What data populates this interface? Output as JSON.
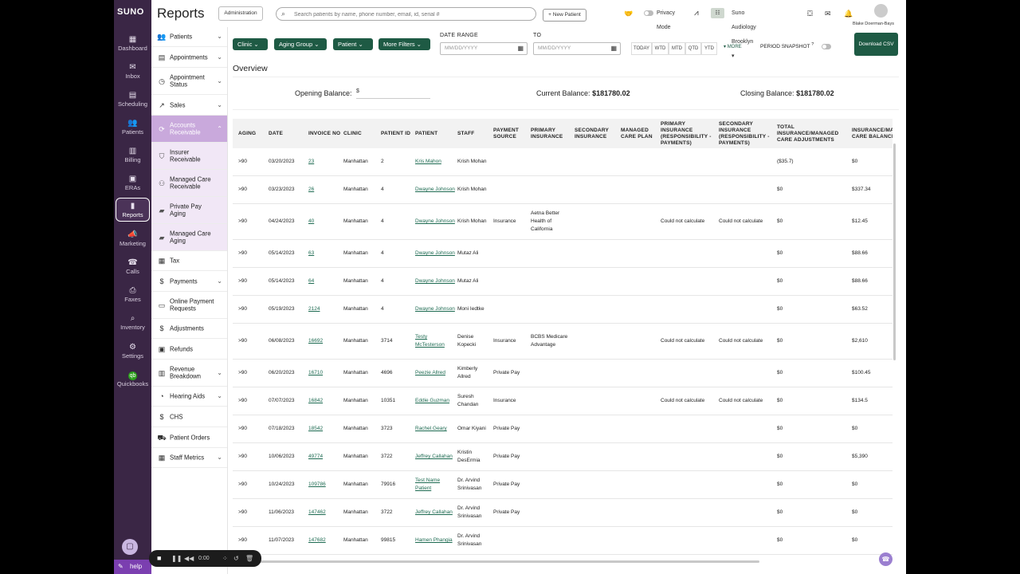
{
  "rail": {
    "logo": "SUNO",
    "items": [
      {
        "label": "Dashboard",
        "icon": "dashboard-icon",
        "glyph": "▦"
      },
      {
        "label": "Inbox",
        "icon": "inbox-icon",
        "glyph": "✉"
      },
      {
        "label": "Scheduling",
        "icon": "calendar-icon",
        "glyph": "▤"
      },
      {
        "label": "Patients",
        "icon": "patients-icon",
        "glyph": "👥"
      },
      {
        "label": "Billing",
        "icon": "billing-icon",
        "glyph": "▥"
      },
      {
        "label": "ERAs",
        "icon": "eras-icon",
        "glyph": "▣"
      },
      {
        "label": "Reports",
        "icon": "reports-icon",
        "glyph": "▮"
      },
      {
        "label": "Marketing",
        "icon": "megaphone-icon",
        "glyph": "📣"
      },
      {
        "label": "Calls",
        "icon": "phone-icon",
        "glyph": "☎"
      },
      {
        "label": "Faxes",
        "icon": "fax-icon",
        "glyph": "⎙"
      },
      {
        "label": "Inventory",
        "icon": "inventory-icon",
        "glyph": "⌕"
      },
      {
        "label": "Settings",
        "icon": "gear-icon",
        "glyph": "⚙"
      },
      {
        "label": "Quickbooks",
        "icon": "quickbooks-icon",
        "glyph": "qb"
      }
    ],
    "help_label": "help"
  },
  "header": {
    "title": "Reports",
    "admin_label": "Administration",
    "search_placeholder": "Search patients by name, phone number, email, id, serial #",
    "new_patient_label": "+ New Patient",
    "privacy_label": "Privacy Mode",
    "location_label": "Suno Audiology Brooklyn",
    "user_name": "Blake Doerman-Bays"
  },
  "sidebar": [
    {
      "label": "Patients",
      "icon": "patients-icon",
      "glyph": "👥",
      "chevron": true
    },
    {
      "label": "Appointments",
      "icon": "calendar-icon",
      "glyph": "▤",
      "chevron": true
    },
    {
      "label": "Appointment Status",
      "icon": "clock-icon",
      "glyph": "◷",
      "chevron": true
    },
    {
      "label": "Sales",
      "icon": "trend-icon",
      "glyph": "↗",
      "chevron": true
    },
    {
      "label": "Accounts Receivable",
      "icon": "receivable-icon",
      "glyph": "⟳",
      "chevron": true,
      "open": true
    },
    {
      "label": "Insurer Receivable",
      "icon": "shield-icon",
      "glyph": "⛉",
      "sub": true
    },
    {
      "label": "Managed Care Receivable",
      "icon": "care-icon",
      "glyph": "⚇",
      "sub": true
    },
    {
      "label": "Private Pay Aging",
      "icon": "folder-icon",
      "glyph": "▰",
      "sub": true
    },
    {
      "label": "Managed Care Aging",
      "icon": "folder-icon",
      "glyph": "▰",
      "sub": true
    },
    {
      "label": "Tax",
      "icon": "tax-icon",
      "glyph": "▦"
    },
    {
      "label": "Payments",
      "icon": "dollar-icon",
      "glyph": "$",
      "chevron": true
    },
    {
      "label": "Online Payment Requests",
      "icon": "card-icon",
      "glyph": "▭"
    },
    {
      "label": "Adjustments",
      "icon": "dollar-icon",
      "glyph": "$"
    },
    {
      "label": "Refunds",
      "icon": "refund-icon",
      "glyph": "▣"
    },
    {
      "label": "Revenue Breakdown",
      "icon": "revenue-icon",
      "glyph": "▥",
      "chevron": true
    },
    {
      "label": "Hearing Aids",
      "icon": "hearing-aid-icon",
      "glyph": "◔",
      "chevron": true
    },
    {
      "label": "CHS",
      "icon": "dollar-icon",
      "glyph": "$"
    },
    {
      "label": "Patient Orders",
      "icon": "truck-icon",
      "glyph": "⛟"
    },
    {
      "label": "Staff Metrics",
      "icon": "metrics-icon",
      "glyph": "▦",
      "chevron": true
    }
  ],
  "filters": {
    "buttons": [
      "Clinic",
      "Aging Group",
      "Patient",
      "More Filters"
    ],
    "date_range_label": "DATE RANGE",
    "to_label": "TO",
    "date_placeholder": "MM/DD/YYYY",
    "quick_ranges": [
      "TODAY",
      "WTD",
      "MTD",
      "QTD",
      "YTD"
    ],
    "more_label": "MORE",
    "snapshot_label": "PERIOD SNAPSHOT",
    "download_label": "Download CSV"
  },
  "overview": {
    "title": "Overview",
    "opening_label": "Opening Balance:",
    "opening_value": "$",
    "current_label": "Current Balance:",
    "current_value": "$181780.02",
    "closing_label": "Closing Balance:",
    "closing_value": "$181780.02"
  },
  "table": {
    "columns": [
      "AGING",
      "DATE",
      "INVOICE NO",
      "CLINIC",
      "PATIENT ID",
      "PATIENT",
      "STAFF",
      "PAYMENT SOURCE",
      "PRIMARY INSURANCE",
      "SECONDARY INSURANCE",
      "MANAGED CARE PLAN",
      "PRIMARY INSURANCE (RESPONSIBILITY - PAYMENTS)",
      "SECONDARY INSURANCE (RESPONSIBILITY - PAYMENTS)",
      "TOTAL INSURANCE/MANAGED CARE ADJUSTMENTS",
      "INSURANCE/MANAGED CARE BALANCE"
    ],
    "rows": [
      [
        ">90",
        "03/20/2023",
        "23",
        "Manhattan",
        "2",
        "Kris Mahon",
        "Krish Mohan",
        "",
        "",
        "",
        "",
        "",
        "",
        "($35.7)",
        "$0"
      ],
      [
        ">90",
        "03/23/2023",
        "26",
        "Manhattan",
        "4",
        "Dwayne Johnson",
        "Krish Mohan",
        "",
        "",
        "",
        "",
        "",
        "",
        "$0",
        "$337.34"
      ],
      [
        ">90",
        "04/24/2023",
        "40",
        "Manhattan",
        "4",
        "Dwayne Johnson",
        "Krish Mohan",
        "Insurance",
        "Aetna Better Health of California",
        "",
        "",
        "Could not calculate",
        "Could not calculate",
        "$0",
        "$12.45"
      ],
      [
        ">90",
        "05/14/2023",
        "63",
        "Manhattan",
        "4",
        "Dwayne Johnson",
        "Mutaz Ali",
        "",
        "",
        "",
        "",
        "",
        "",
        "$0",
        "$88.66"
      ],
      [
        ">90",
        "05/14/2023",
        "64",
        "Manhattan",
        "4",
        "Dwayne Johnson",
        "Mutaz Ali",
        "",
        "",
        "",
        "",
        "",
        "",
        "$0",
        "$88.66"
      ],
      [
        ">90",
        "05/19/2023",
        "2124",
        "Manhattan",
        "4",
        "Dwayne Johnson",
        "Moni Iedtke",
        "",
        "",
        "",
        "",
        "",
        "",
        "$0",
        "$63.52"
      ],
      [
        ">90",
        "06/08/2023",
        "16692",
        "Manhattan",
        "3714",
        "Testy McTesterson",
        "Denise Kopecki",
        "Insurance",
        "BCBS Medicare Advantage",
        "",
        "",
        "Could not calculate",
        "Could not calculate",
        "$0",
        "$2,610"
      ],
      [
        ">90",
        "06/20/2023",
        "16710",
        "Manhattan",
        "4696",
        "Peezie Allred",
        "Kimberly Allred",
        "Private Pay",
        "",
        "",
        "",
        "",
        "",
        "$0",
        "$100.45"
      ],
      [
        ">90",
        "07/07/2023",
        "16842",
        "Manhattan",
        "10351",
        "Eddie Guzman",
        "Suresh Chandan",
        "Insurance",
        "",
        "",
        "",
        "Could not calculate",
        "Could not calculate",
        "$0",
        "$134.5"
      ],
      [
        ">90",
        "07/18/2023",
        "18542",
        "Manhattan",
        "3723",
        "Rachel Geary",
        "Omar Kiyani",
        "Private Pay",
        "",
        "",
        "",
        "",
        "",
        "$0",
        "$0"
      ],
      [
        ">90",
        "10/06/2023",
        "49774",
        "Manhattan",
        "3722",
        "Jeffrey Callahan",
        "Kristin DesErmia",
        "Private Pay",
        "",
        "",
        "",
        "",
        "",
        "$0",
        "$5,390"
      ],
      [
        ">90",
        "10/24/2023",
        "109786",
        "Manhattan",
        "79916",
        "Test Name Patient",
        "Dr. Arvind Srinivasan",
        "Private Pay",
        "",
        "",
        "",
        "",
        "",
        "$0",
        "$0"
      ],
      [
        ">90",
        "11/06/2023",
        "147462",
        "Manhattan",
        "3722",
        "Jeffrey Callahan",
        "Dr. Arvind Srinivasan",
        "Private Pay",
        "",
        "",
        "",
        "",
        "",
        "$0",
        "$0"
      ],
      [
        ">90",
        "11/07/2023",
        "147682",
        "Manhattan",
        "99815",
        "Hamen Phangia",
        "Dr. Arvind Srinivasan",
        "",
        "",
        "",
        "",
        "",
        "",
        "$0",
        "$0"
      ]
    ]
  },
  "recorder": {
    "time": "0:00"
  }
}
